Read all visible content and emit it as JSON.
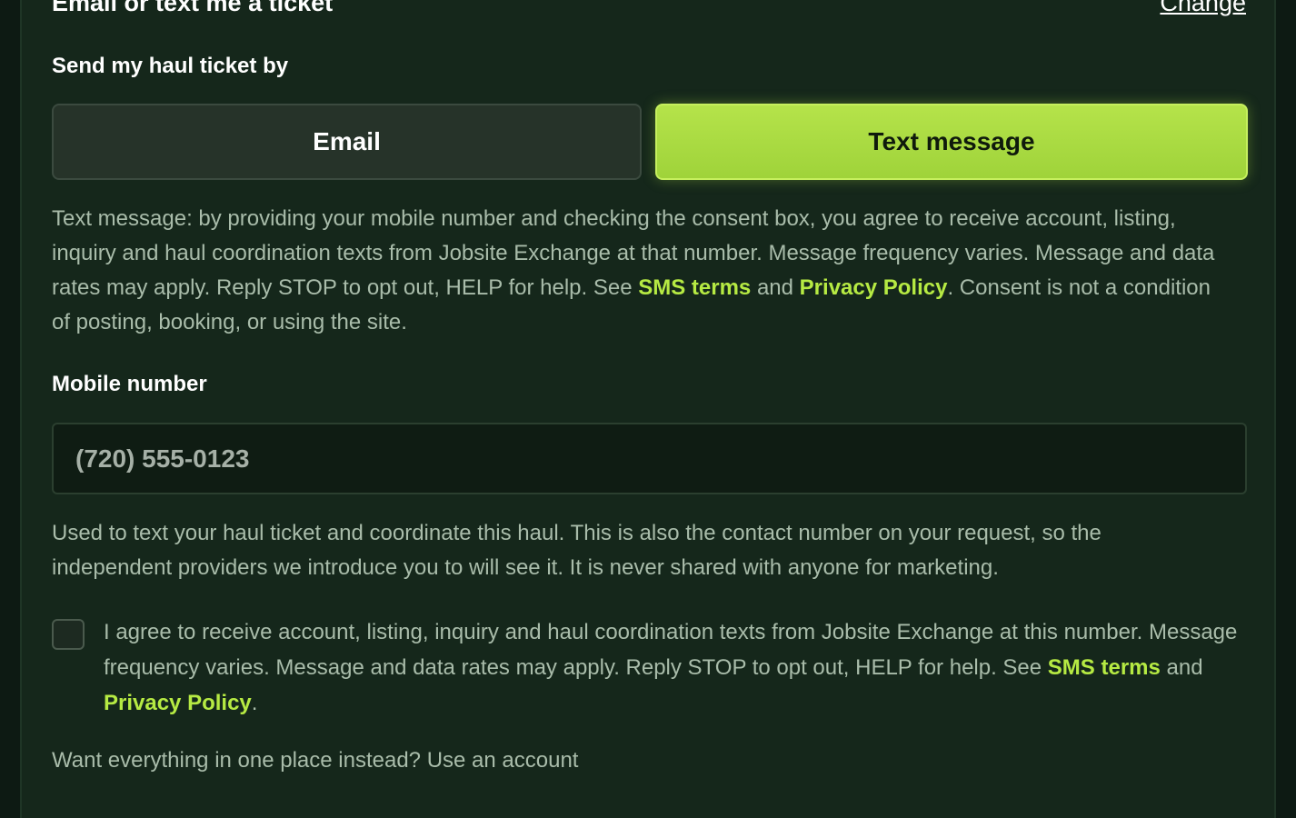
{
  "header": {
    "title": "Email or text me a ticket",
    "change_label": "Change"
  },
  "delivery": {
    "label": "Send my haul ticket by",
    "options": [
      "Email",
      "Text message"
    ],
    "selected": "Text message"
  },
  "sms_disclosure": {
    "text_before_links": "Text message: by providing your mobile number and checking the consent box, you agree to receive account, listing, inquiry and haul coordination texts from Jobsite Exchange at that number. Message frequency varies. Message and data rates may apply. Reply STOP to opt out, HELP for help. See ",
    "sms_terms_label": "SMS terms",
    "and_text": " and ",
    "privacy_label": "Privacy Policy",
    "text_after_links": ". Consent is not a condition of posting, booking, or using the site."
  },
  "mobile": {
    "label": "Mobile number",
    "placeholder": "(720) 555-0123",
    "value": "",
    "help_text": "Used to text your haul ticket and coordinate this haul. This is also the contact number on your request, so the independent providers we introduce you to will see it. It is never shared with anyone for marketing."
  },
  "consent": {
    "checked": false,
    "text_before_links": "I agree to receive account, listing, inquiry and haul coordination texts from Jobsite Exchange at this number. Message frequency varies. Message and data rates may apply. Reply STOP to opt out, HELP for help. See ",
    "sms_terms_label": "SMS terms",
    "and_text": " and ",
    "privacy_label": "Privacy Policy",
    "text_after_links": "."
  },
  "footer": {
    "prompt": "Want everything in one place instead? ",
    "account_link": "Use an account"
  },
  "colors": {
    "accent": "#b6ea43",
    "background": "#15271b",
    "muted_text": "#a9bcaa"
  }
}
